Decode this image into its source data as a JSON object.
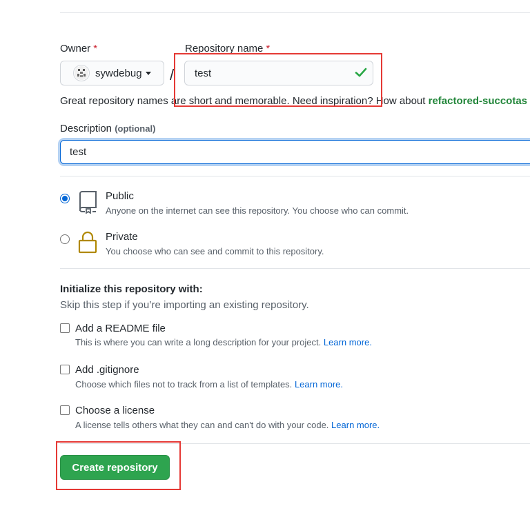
{
  "owner": {
    "label": "Owner",
    "required_mark": "*",
    "username": "sywdebug",
    "avatar_icon": "identicon-avatar"
  },
  "separator": "/",
  "repo_name": {
    "label": "Repository name",
    "required_mark": "*",
    "value": "test",
    "valid_icon": "checkmark-icon"
  },
  "hint": {
    "text": "Great repository names are short and memorable. Need inspiration? How about",
    "suggestion": "refactored-succotas"
  },
  "description": {
    "label": "Description",
    "optional": "(optional)",
    "value": "test"
  },
  "visibility": {
    "public": {
      "title": "Public",
      "desc": "Anyone on the internet can see this repository. You choose who can commit.",
      "selected": true,
      "icon": "repo-icon"
    },
    "private": {
      "title": "Private",
      "desc": "You choose who can see and commit to this repository.",
      "selected": false,
      "icon": "lock-icon"
    }
  },
  "init": {
    "title": "Initialize this repository with:",
    "subtitle": "Skip this step if you’re importing an existing repository.",
    "options": [
      {
        "title": "Add a README file",
        "desc": "This is where you can write a long description for your project.",
        "link": "Learn more."
      },
      {
        "title": "Add .gitignore",
        "desc": "Choose which files not to track from a list of templates.",
        "link": "Learn more."
      },
      {
        "title": "Choose a license",
        "desc": "A license tells others what they can and can't do with your code.",
        "link": "Learn more."
      }
    ]
  },
  "create_button": "Create repository",
  "colors": {
    "accent_blue": "#0366d6",
    "create_green": "#2ea44f",
    "suggestion_green": "#22863a",
    "annotation_red": "#e53935",
    "lock_gold": "#b08800"
  }
}
